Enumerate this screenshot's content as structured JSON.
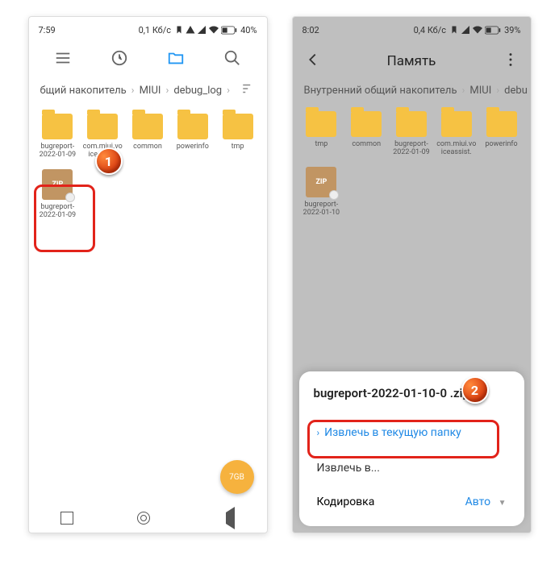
{
  "left": {
    "status": {
      "time": "7:59",
      "speed": "0,1 Кб/с",
      "battery": "40%"
    },
    "breadcrumb": [
      "бщий накопитель",
      "MIUI",
      "debug_log"
    ],
    "files": [
      {
        "type": "folder",
        "label": "bugreport-2022-01-09"
      },
      {
        "type": "folder",
        "label": "com.miui.voiceassist"
      },
      {
        "type": "folder",
        "label": "common"
      },
      {
        "type": "folder",
        "label": "powerinfo"
      },
      {
        "type": "folder",
        "label": "tmp"
      },
      {
        "type": "zip",
        "label": "bugreport-2022-01-09"
      }
    ],
    "zip_label": "ZIP",
    "fab": "7GB",
    "marker": "1"
  },
  "right": {
    "status": {
      "time": "8:02",
      "speed": "0,4 Кб/с",
      "battery": "39%"
    },
    "title": "Память",
    "breadcrumb": [
      "Внутренний общий накопитель",
      "MIUI",
      "debu"
    ],
    "files": [
      {
        "type": "folder",
        "label": "tmp"
      },
      {
        "type": "folder",
        "label": "common"
      },
      {
        "type": "folder",
        "label": "bugreport-2022-01-09"
      },
      {
        "type": "folder",
        "label": "com.miui.voiceassist."
      },
      {
        "type": "folder",
        "label": "powerinfo"
      },
      {
        "type": "zip",
        "label": "bugreport-2022-01-10"
      }
    ],
    "zip_label": "ZIP",
    "sheet": {
      "filename": "bugreport-2022-01-10-0          .zip",
      "extract_here": "Извлечь в текущую папку",
      "extract_to": "Извлечь в...",
      "encoding_label": "Кодировка",
      "encoding_value": "Авто"
    },
    "marker": "2"
  }
}
